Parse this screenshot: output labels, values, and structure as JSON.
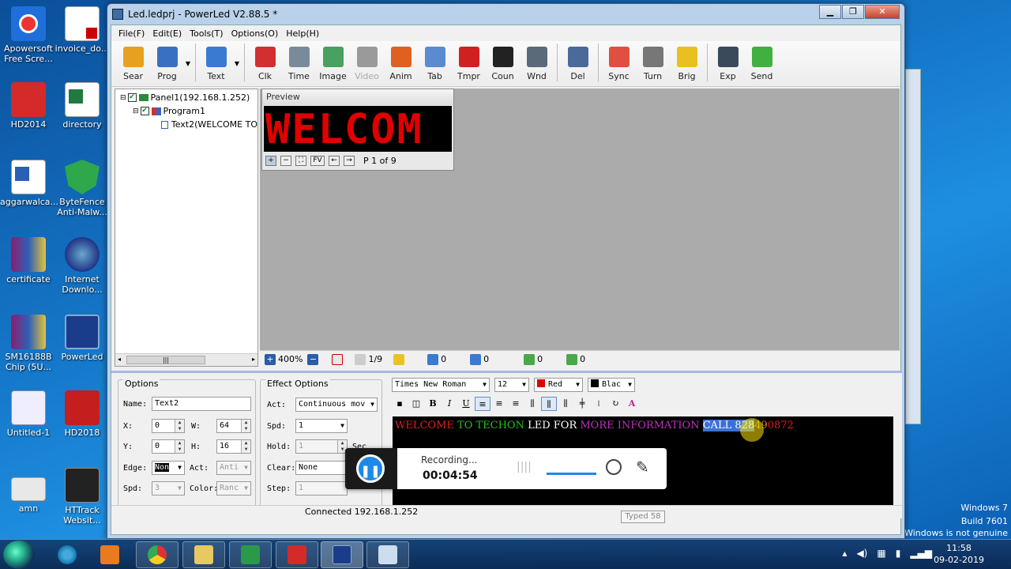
{
  "desktop": {
    "icons_left": [
      "Apowersoft Free Scre...",
      "HD2014",
      "aggarwalca...",
      "certificate",
      "SM16188B Chip (5U...",
      "Untitled-1",
      "amn"
    ],
    "icons_right": [
      "invoice_do...",
      "directory",
      "ByteFence Anti-Malw...",
      "Internet Downlo...",
      "PowerLed",
      "HD2018",
      "HTTrack Websit..."
    ],
    "watermark": [
      "Windows 7",
      "Build 7601",
      "f Windows is not genuine"
    ]
  },
  "window": {
    "title": "Led.ledprj - PowerLed V2.88.5 *",
    "buttons": [
      "▁",
      "❐",
      "✕"
    ]
  },
  "menu": [
    "File(F)",
    "Edit(E)",
    "Tools(T)",
    "Options(O)",
    "Help(H)"
  ],
  "toolbar": [
    {
      "label": "Sear",
      "icon": "search-icon",
      "color": "#e8a020"
    },
    {
      "label": "Prog",
      "icon": "program-icon",
      "color": "#3a70c0"
    },
    {
      "label": "Text",
      "icon": "text-icon",
      "color": "#3a7ad0"
    },
    {
      "label": "Clk",
      "icon": "clock-icon",
      "color": "#d03030"
    },
    {
      "label": "Time",
      "icon": "calendar-icon",
      "color": "#7a8a9a"
    },
    {
      "label": "Image",
      "icon": "image-icon",
      "color": "#4aa060"
    },
    {
      "label": "Video",
      "icon": "video-icon",
      "color": "#9a9a9a"
    },
    {
      "label": "Anim",
      "icon": "animation-icon",
      "color": "#e06020"
    },
    {
      "label": "Tab",
      "icon": "table-icon",
      "color": "#5a8ad0"
    },
    {
      "label": "Tmpr",
      "icon": "thermometer-icon",
      "color": "#d02020"
    },
    {
      "label": "Coun",
      "icon": "counter-icon",
      "color": "#222222"
    },
    {
      "label": "Wnd",
      "icon": "window-icon",
      "color": "#5a6a7a"
    },
    {
      "label": "Del",
      "icon": "delete-icon",
      "color": "#4a6a9a"
    },
    {
      "label": "Sync",
      "icon": "sync-clock-icon",
      "color": "#e05040"
    },
    {
      "label": "Turn",
      "icon": "power-icon",
      "color": "#777777"
    },
    {
      "label": "Brig",
      "icon": "bulb-icon",
      "color": "#e8c020"
    },
    {
      "label": "Exp",
      "icon": "export-icon",
      "color": "#3a4a5a"
    },
    {
      "label": "Send",
      "icon": "send-icon",
      "color": "#40b040"
    }
  ],
  "tree": [
    {
      "label": "Panel1(192.168.1.252)"
    },
    {
      "label": "Program1"
    },
    {
      "label": "Text2(WELCOME TO"
    }
  ],
  "preview": {
    "title": "Preview",
    "led_text": "WELCOM",
    "page": "P 1 of 9",
    "fv": "FV"
  },
  "strip": {
    "zoom": "400%",
    "page": "1/9",
    "v1": "0",
    "v2": "0",
    "v3": "0",
    "v4": "0"
  },
  "options": {
    "title": "Options",
    "name_label": "Name:",
    "name_value": "Text2",
    "x_label": "X:",
    "x_value": "0",
    "w_label": "W:",
    "w_value": "64",
    "y_label": "Y:",
    "y_value": "0",
    "h_label": "H:",
    "h_value": "16",
    "edge_label": "Edge:",
    "edge_value": "Non",
    "act_label": "Act:",
    "act_value": "Anti",
    "spd_label": "Spd:",
    "spd_value": "3",
    "color_label": "Color:",
    "color_value": "Ranc"
  },
  "effect": {
    "title": "Effect Options",
    "act_label": "Act:",
    "act_value": "Continuous mov",
    "spd_label": "Spd:",
    "spd_value": "1",
    "hold_label": "Hold:",
    "hold_value": "1",
    "hold_unit": "Sec",
    "clear_label": "Clear:",
    "clear_value": "None",
    "step_label": "Step:",
    "step_value": "1"
  },
  "format": {
    "font": "Times New Roman",
    "size": "12",
    "fg_label": "Red",
    "fg_color": "#e00000",
    "bg_label": "Blac",
    "bg_color": "#000000"
  },
  "editor": {
    "seg1": "WELCOME",
    "seg2": " TO TECHON ",
    "seg3": "LED FOR ",
    "seg4": "MORE INFORMATION ",
    "seg5": "CALL 828",
    "seg6": "49",
    "seg7": "0872"
  },
  "recording": {
    "label": "Recording...",
    "time": "00:04:54"
  },
  "tooltip": "Typed 58",
  "statusbar": "Connected 192.168.1.252",
  "taskbar": {
    "time": "11:58",
    "date": "09-02-2019"
  }
}
